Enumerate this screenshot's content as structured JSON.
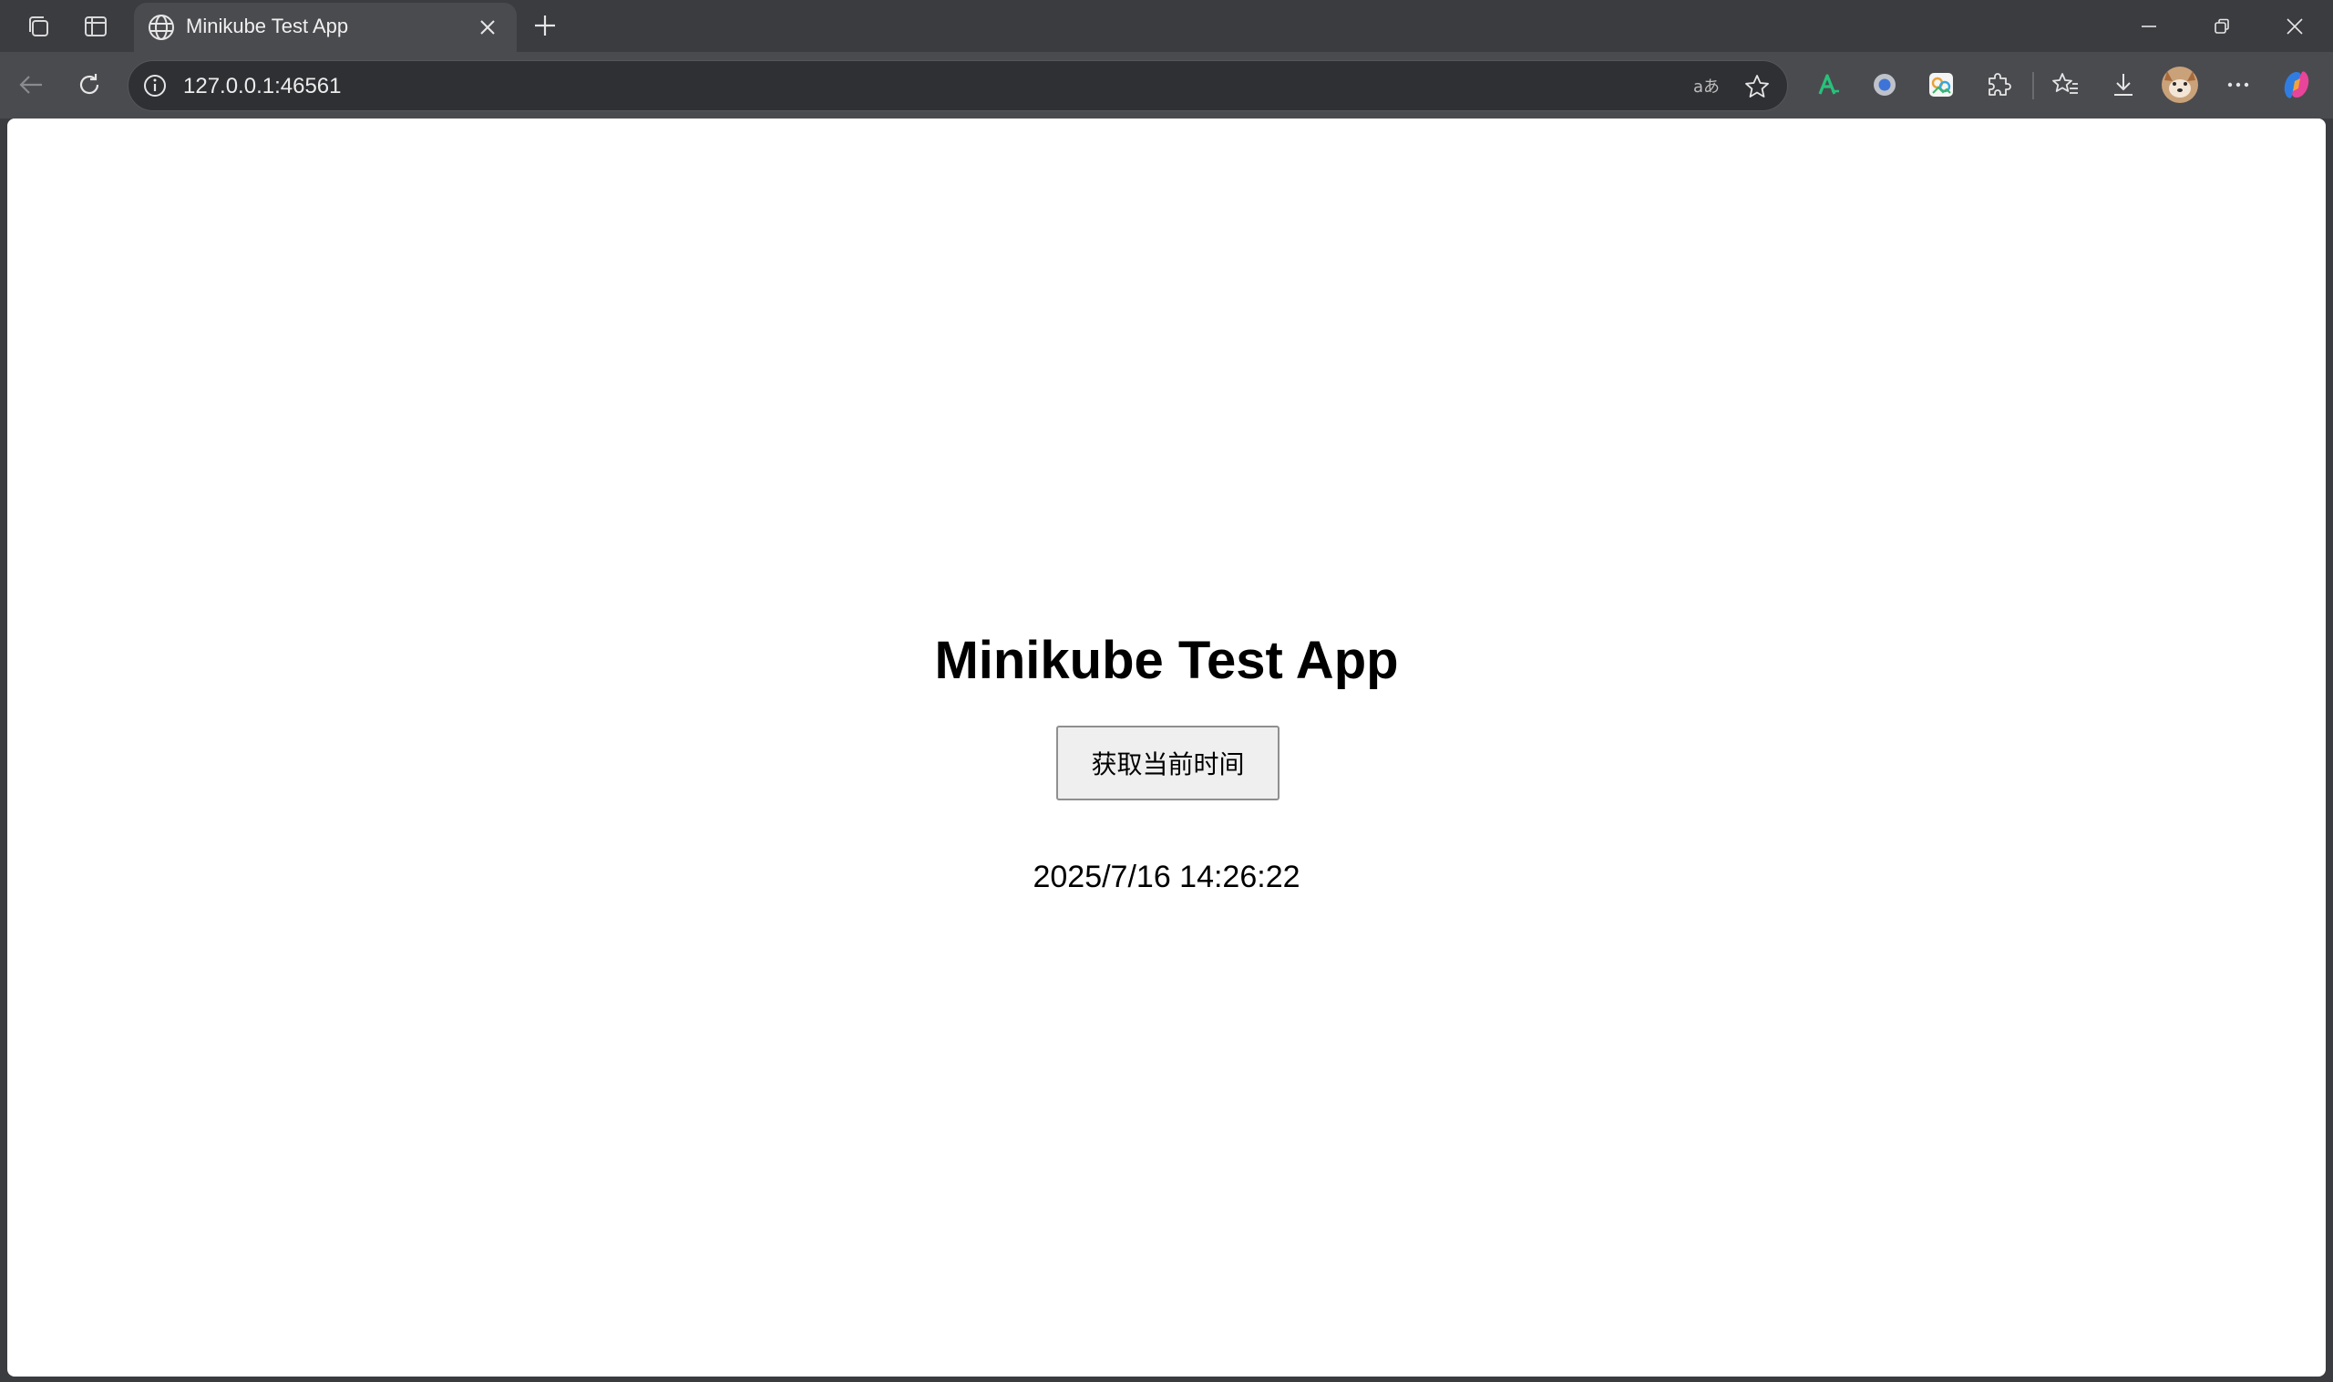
{
  "browser": {
    "tab": {
      "title": "Minikube Test App"
    },
    "address_bar": {
      "url": "127.0.0.1:46561"
    }
  },
  "page": {
    "title": "Minikube Test App",
    "button_label": "获取当前时间",
    "result_text": "2025/7/16 14:26:22"
  },
  "colors": {
    "chrome_dark": "#3b3c40",
    "chrome_toolbar": "#4a4b4f",
    "page_background": "#ffffff",
    "button_background": "#efefef"
  },
  "icons": [
    "workspaces-icon",
    "tab-actions-icon",
    "globe-icon",
    "close-icon",
    "plus-icon",
    "minimize-icon",
    "restore-icon",
    "back-arrow-icon",
    "reload-icon",
    "info-icon",
    "read-aloud-icon",
    "star-icon",
    "extension-icon",
    "favorites-icon",
    "download-icon",
    "avatar",
    "more-icon",
    "copilot-icon"
  ]
}
